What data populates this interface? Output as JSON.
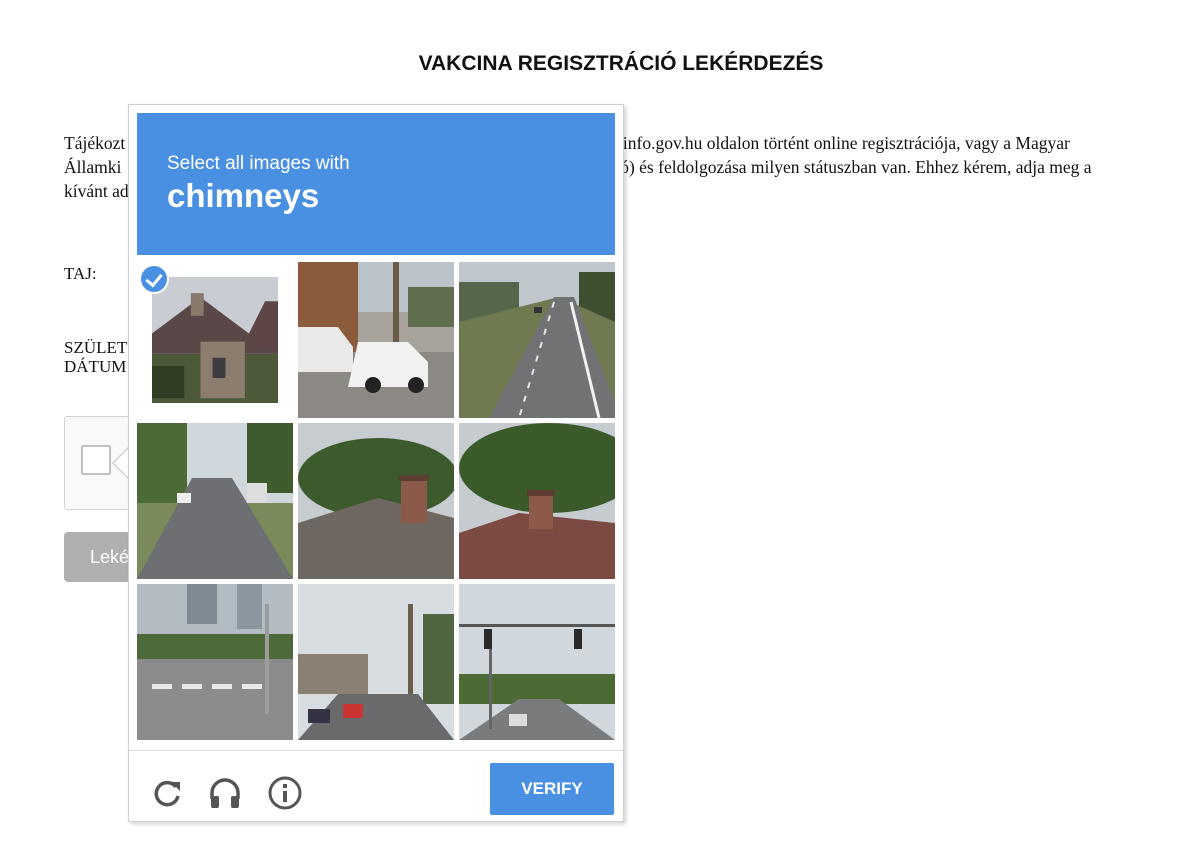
{
  "page": {
    "title": "VAKCINA REGISZTRÁCIÓ LEKÉRDEZÉS",
    "intro_line1": "Tájékozt",
    "intro_line1_end": "akcinainfo.gov.hu oldalon történt online regisztrációja, vagy a Magyar",
    "intro_line2": "Államki",
    "intro_line2_end": "ztráció) és feldolgozása milyen státuszban van. Ehhez kérem, adja meg a",
    "intro_line3": "kívánt ad",
    "taj_label": "TAJ:",
    "birth_label_1": "SZÜLET",
    "birth_label_2": "DÁTUM",
    "submit_label": "Leké"
  },
  "captcha": {
    "instruction": "Select all images with",
    "target": "chimneys",
    "verify_label": "VERIFY",
    "tiles": [
      {
        "scene": "house-with-chimney",
        "selected": true
      },
      {
        "scene": "parked-cars",
        "selected": false
      },
      {
        "scene": "highway",
        "selected": false
      },
      {
        "scene": "residential-street",
        "selected": false
      },
      {
        "scene": "roof-chimney",
        "selected": false
      },
      {
        "scene": "roof-chimney",
        "selected": false
      },
      {
        "scene": "crosswalk",
        "selected": false
      },
      {
        "scene": "busy-street",
        "selected": false
      },
      {
        "scene": "traffic-lights-road",
        "selected": false
      }
    ],
    "footer_icons": [
      "reload-icon",
      "headphones-icon",
      "info-icon"
    ],
    "accent_color": "#4a90e2"
  }
}
